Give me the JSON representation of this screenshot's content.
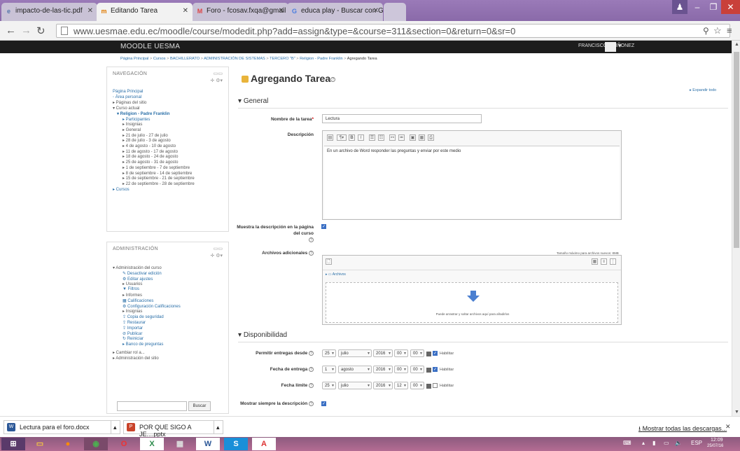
{
  "browser": {
    "tabs": [
      {
        "title": "impacto-de-las-tic.pdf",
        "icon": "pdf-tab-icon"
      },
      {
        "title": "Editando Tarea",
        "icon": "moodle-tab-icon",
        "active": true
      },
      {
        "title": "Foro - fcosav.fxqa@gmail",
        "icon": "gmail-tab-icon"
      },
      {
        "title": "educa play - Buscar con G",
        "icon": "google-tab-icon"
      }
    ],
    "url": "www.uesmae.edu.ec/moodle/course/modedit.php?add=assign&type=&course=311&section=0&return=0&sr=0"
  },
  "header": {
    "brand": "MOODLE UESMA",
    "user": "FRANCISCO QUIÑONEZ"
  },
  "breadcrumb": [
    "Página Principal",
    "Cursos",
    "BACHILLERATO",
    "ADMINISTRACIÓN DE SISTEMAS",
    "TERCERO \"B\"",
    "Religion - Padre Franklin",
    "Agregando Tarea"
  ],
  "nav_block": {
    "title": "NAVEGACIÓN",
    "items": [
      {
        "label": "Página Principal",
        "style": "link"
      },
      {
        "label": "◦ Área personal",
        "style": "link"
      },
      {
        "label": "▸ Páginas del sitio",
        "style": "plain"
      },
      {
        "label": "▾ Curso actual",
        "style": "plain"
      },
      {
        "label": "▾ Religion - Padre Franklin",
        "style": "bold"
      },
      {
        "label": "▸ Participantes",
        "style": "link"
      },
      {
        "label": "▸ Insignias",
        "style": "plain"
      },
      {
        "label": "▸ General",
        "style": "plain"
      },
      {
        "label": "▸ 21 de julio - 27 de julio",
        "style": "plain"
      },
      {
        "label": "▸ 28 de julio - 3 de agosto",
        "style": "plain"
      },
      {
        "label": "▸ 4 de agosto - 10 de agosto",
        "style": "plain"
      },
      {
        "label": "▸ 11 de agosto - 17 de agosto",
        "style": "plain"
      },
      {
        "label": "▸ 18 de agosto - 24 de agosto",
        "style": "plain"
      },
      {
        "label": "▸ 25 de agosto - 31 de agosto",
        "style": "plain"
      },
      {
        "label": "▸ 1 de septiembre - 7 de septiembre",
        "style": "plain"
      },
      {
        "label": "▸ 8 de septiembre - 14 de septiembre",
        "style": "plain"
      },
      {
        "label": "▸ 15 de septiembre - 21 de septiembre",
        "style": "plain"
      },
      {
        "label": "▸ 22 de septiembre - 28 de septiembre",
        "style": "plain"
      },
      {
        "label": "▸ Cursos",
        "style": "link"
      }
    ]
  },
  "admin_block": {
    "title": "ADMINISTRACIÓN",
    "items": [
      {
        "label": "▾ Administración del curso",
        "style": "plain"
      },
      {
        "label": "✎ Desactivar edición",
        "style": "link"
      },
      {
        "label": "⚙ Editar ajustes",
        "style": "link"
      },
      {
        "label": "▸ Usuarios",
        "style": "plain"
      },
      {
        "label": "▼ Filtros",
        "style": "link"
      },
      {
        "label": "▸ Informes",
        "style": "plain"
      },
      {
        "label": "▦ Calificaciones",
        "style": "link"
      },
      {
        "label": "⚙ Configuración Calificaciones",
        "style": "link"
      },
      {
        "label": "▸ Insignias",
        "style": "plain"
      },
      {
        "label": "⇪ Copia de seguridad",
        "style": "link"
      },
      {
        "label": "⇪ Restaurar",
        "style": "link"
      },
      {
        "label": "⇪ Importar",
        "style": "link"
      },
      {
        "label": "⊘ Publicar",
        "style": "link"
      },
      {
        "label": "↻ Reiniciar",
        "style": "link"
      },
      {
        "label": "▸ Banco de preguntas",
        "style": "link"
      },
      {
        "label": "▸ Cambiar rol a...",
        "style": "plain"
      },
      {
        "label": "▸ Administración del sitio",
        "style": "plain"
      }
    ],
    "search_button": "Buscar"
  },
  "form": {
    "title": "Agregando Tarea",
    "expand_all": "▸ Expandir todo",
    "general_section": "General",
    "name_label": "Nombre de la tarea",
    "name_value": "Lectura",
    "description_label": "Descripción",
    "description_text": "En un archivo de Word responder las preguntas y enviar por este medio",
    "show_description_label": "Muestra la descripción en la página del curso",
    "files_label": "Archivos adicionales",
    "max_size_note": "Tamaño máximo para archivos nuevos: 8MB",
    "folder_label": "▸ ▭ Archivos",
    "drop_hint": "Puede arrastrar y soltar archivos aquí para añadirlos",
    "availability_section": "Disponibilidad",
    "dates": [
      {
        "label": "Permitir entregas desde",
        "day": "25",
        "month": "julio",
        "year": "2016",
        "hour": "00",
        "minute": "00",
        "enabled": true
      },
      {
        "label": "Fecha de entrega",
        "day": "1",
        "month": "agosto",
        "year": "2016",
        "hour": "00",
        "minute": "00",
        "enabled": true
      },
      {
        "label": "Fecha límite",
        "day": "25",
        "month": "julio",
        "year": "2016",
        "hour": "12",
        "minute": "00",
        "enabled": false
      }
    ],
    "enable_label": "Habilitar",
    "always_show_label": "Mostrar siempre la descripción"
  },
  "downloads": {
    "items": [
      "Lectura para el foro.docx",
      "POR QUE SIGO A JE....pptx"
    ],
    "show_all": "Mostrar todas las descargas..."
  },
  "taskbar": {
    "lang": "ESP",
    "time": "12:09",
    "date": "25/07/16"
  }
}
